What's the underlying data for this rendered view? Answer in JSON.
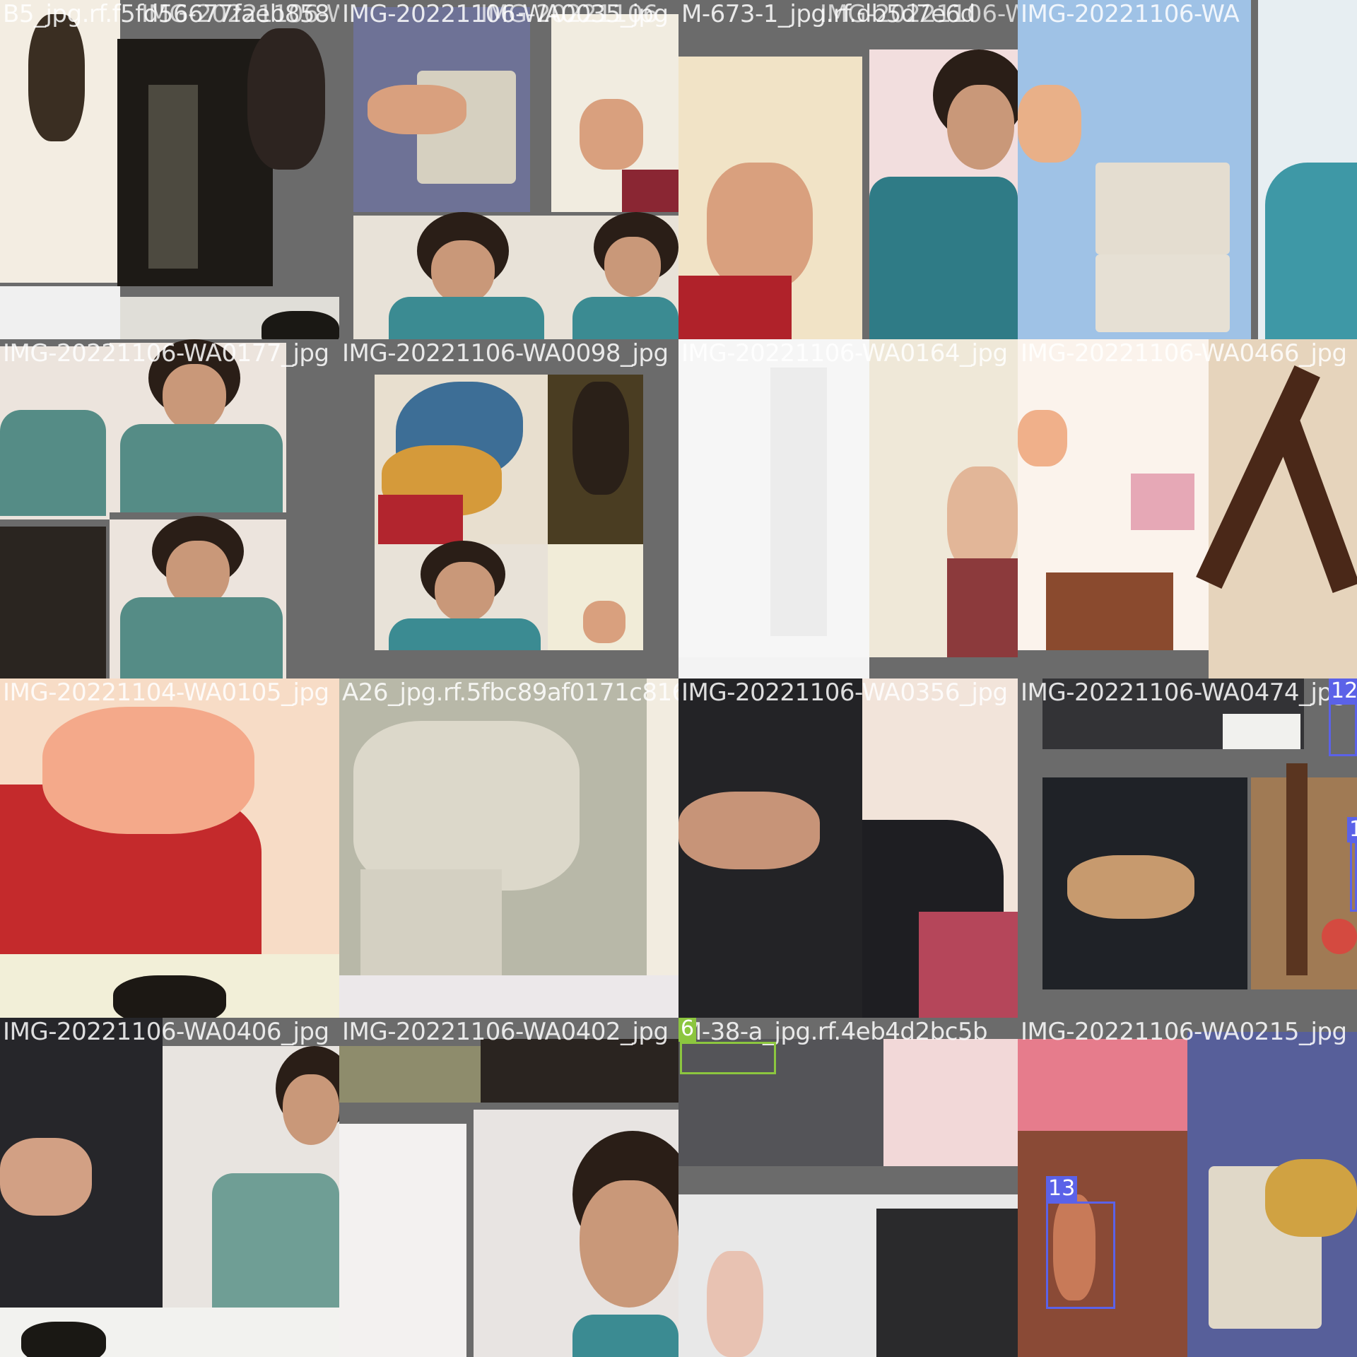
{
  "tiles": [
    {
      "label": "B5_jpg.rf.f5fd56677faeb858",
      "overlay": "IMG-20221106-WA0035_jpg"
    },
    {
      "label": "IMG-20221106-WA0035_jpg",
      "overlay": "IMG-20221106"
    },
    {
      "label": "M-673-1_jpg.rf.db5d7e6d",
      "overlay": "IMG-20221106-WA0"
    },
    {
      "label": "IMG-20221106-WA",
      "overlay": ""
    },
    {
      "label": "IMG-20221106-WA0177_jpg",
      "overlay": ""
    },
    {
      "label": "IMG-20221106-WA0098_jpg",
      "overlay": ""
    },
    {
      "label": "IMG-20221106-WA0164_jpg",
      "overlay": ""
    },
    {
      "label": "IMG-20221106-WA0466_jpg",
      "overlay": ""
    },
    {
      "label": "IMG-20221104-WA0105_jpg",
      "overlay": ""
    },
    {
      "label": "A26_jpg.rf.5fbc89af0171c816",
      "overlay": ""
    },
    {
      "label": "IMG-20221106-WA0356_jpg",
      "overlay": ""
    },
    {
      "label": "IMG-20221106-WA0474_jpg",
      "overlay": ""
    },
    {
      "label": "IMG-20221106-WA0406_jpg",
      "overlay": ""
    },
    {
      "label": "IMG-20221106-WA0402_jpg",
      "overlay": ""
    },
    {
      "label": "M-38-a_jpg.rf.4eb4d2bc5b",
      "overlay": ""
    },
    {
      "label": "IMG-20221106-WA0215_jpg",
      "overlay": ""
    }
  ],
  "detections": [
    {
      "id": "12",
      "color": "#5b62e8"
    },
    {
      "id": "1",
      "color": "#5b62e8"
    },
    {
      "id": "6",
      "color": "#8cc63f"
    },
    {
      "id": "13",
      "color": "#5b62e8"
    }
  ]
}
